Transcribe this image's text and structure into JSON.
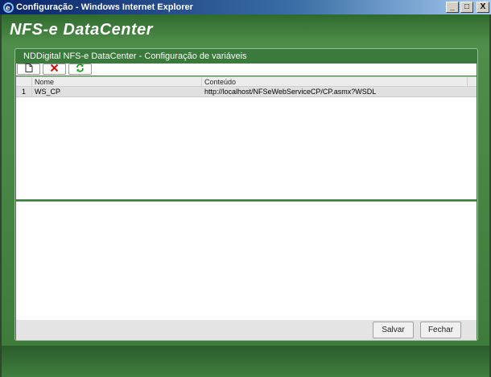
{
  "window": {
    "title": "Configuração - Windows Internet Explorer",
    "buttons": {
      "minimize": "_",
      "maximize": "□",
      "close": "X"
    }
  },
  "app": {
    "brand": "NFS-e DataCenter"
  },
  "panel": {
    "title": "NDDigital NFS-e DataCenter - Configuração de variáveis"
  },
  "toolbar": {
    "buttons": [
      {
        "icon": "new-document-icon"
      },
      {
        "icon": "delete-x-icon"
      },
      {
        "icon": "refresh-icon"
      }
    ]
  },
  "grid": {
    "columns": {
      "nome": "Nome",
      "conteudo": "Conteúdo"
    },
    "rows": [
      {
        "num": "1",
        "nome": "WS_CP",
        "conteudo": "http://localhost/NFSeWebServiceCP/CP.asmx?WSDL"
      }
    ]
  },
  "footer": {
    "save_label": "Salvar",
    "close_label": "Fechar"
  },
  "colors": {
    "background": "#3d6b3d",
    "panel": "#3a7a3a",
    "titlebar_start": "#0a246a"
  }
}
